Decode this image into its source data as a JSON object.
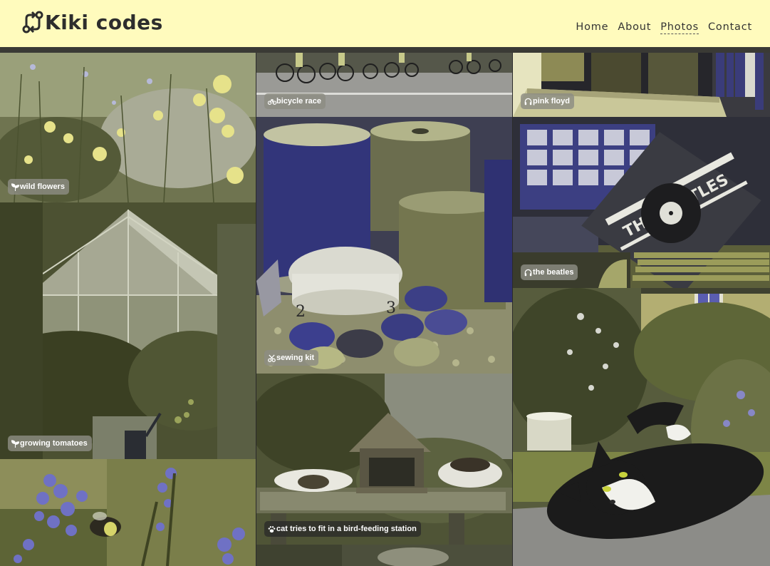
{
  "site": {
    "title": "Kiki codes",
    "logo_icon": "code-branch-icon"
  },
  "nav": [
    {
      "label": "Home",
      "active": false
    },
    {
      "label": "About",
      "active": false
    },
    {
      "label": "Photos",
      "active": true
    },
    {
      "label": "Contact",
      "active": false
    }
  ],
  "photos": [
    {
      "caption": "wild flowers",
      "icon": "seedling-icon"
    },
    {
      "caption": "growing tomatoes",
      "icon": "seedling-icon"
    },
    {
      "caption": "bicycle race",
      "icon": "bicycle-icon"
    },
    {
      "caption": "sewing kit",
      "icon": "scissors-icon"
    },
    {
      "caption": "cat tries to fit in a bird-feeding station",
      "icon": "paw-icon"
    },
    {
      "caption": "pink floyd",
      "icon": "headphones-icon"
    },
    {
      "caption": "the beatles",
      "icon": "headphones-icon"
    }
  ]
}
